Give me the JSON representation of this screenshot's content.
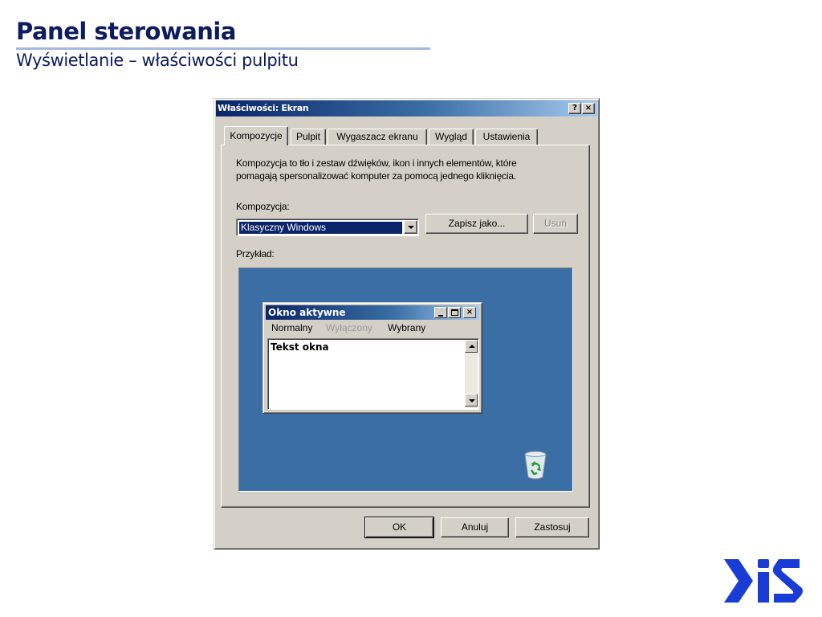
{
  "slide": {
    "title": "Panel sterowania",
    "subtitle": "Wyświetlanie – właściwości pulpitu"
  },
  "dialog": {
    "title": "Właściwości: Ekran",
    "help_button": "?",
    "close_button": "×",
    "tabs": [
      {
        "label": "Kompozycje",
        "active": true
      },
      {
        "label": "Pulpit",
        "active": false
      },
      {
        "label": "Wygaszacz ekranu",
        "active": false
      },
      {
        "label": "Wygląd",
        "active": false
      },
      {
        "label": "Ustawienia",
        "active": false
      }
    ],
    "description_line1": "Kompozycja to tło i zestaw dźwięków, ikon i innych elementów, które",
    "description_line2": "pomagają spersonalizować komputer za pomocą jednego kliknięcia.",
    "theme_label": "Kompozycja:",
    "theme_value": "Klasyczny Windows",
    "save_as_button": "Zapisz jako...",
    "delete_button": "Usuń",
    "preview_label": "Przykład:",
    "ok_button": "OK",
    "cancel_button": "Anuluj",
    "apply_button": "Zastosuj"
  },
  "preview": {
    "window_title": "Okno aktywne",
    "menu_normal": "Normalny",
    "menu_disabled": "Wyłączony",
    "menu_selected": "Wybrany",
    "window_text": "Tekst okna",
    "desktop_color": "#3a6ea5"
  },
  "colors": {
    "title_text": "#0c1c5e",
    "title_rule": "#a6b6dd",
    "logo_blue": "#1a3cd6",
    "titlebar_active": "#0a246a",
    "face": "#d4d0c8"
  },
  "icons": {
    "recycle_bin": "recycle-bin-icon",
    "logo": "company-logo"
  }
}
